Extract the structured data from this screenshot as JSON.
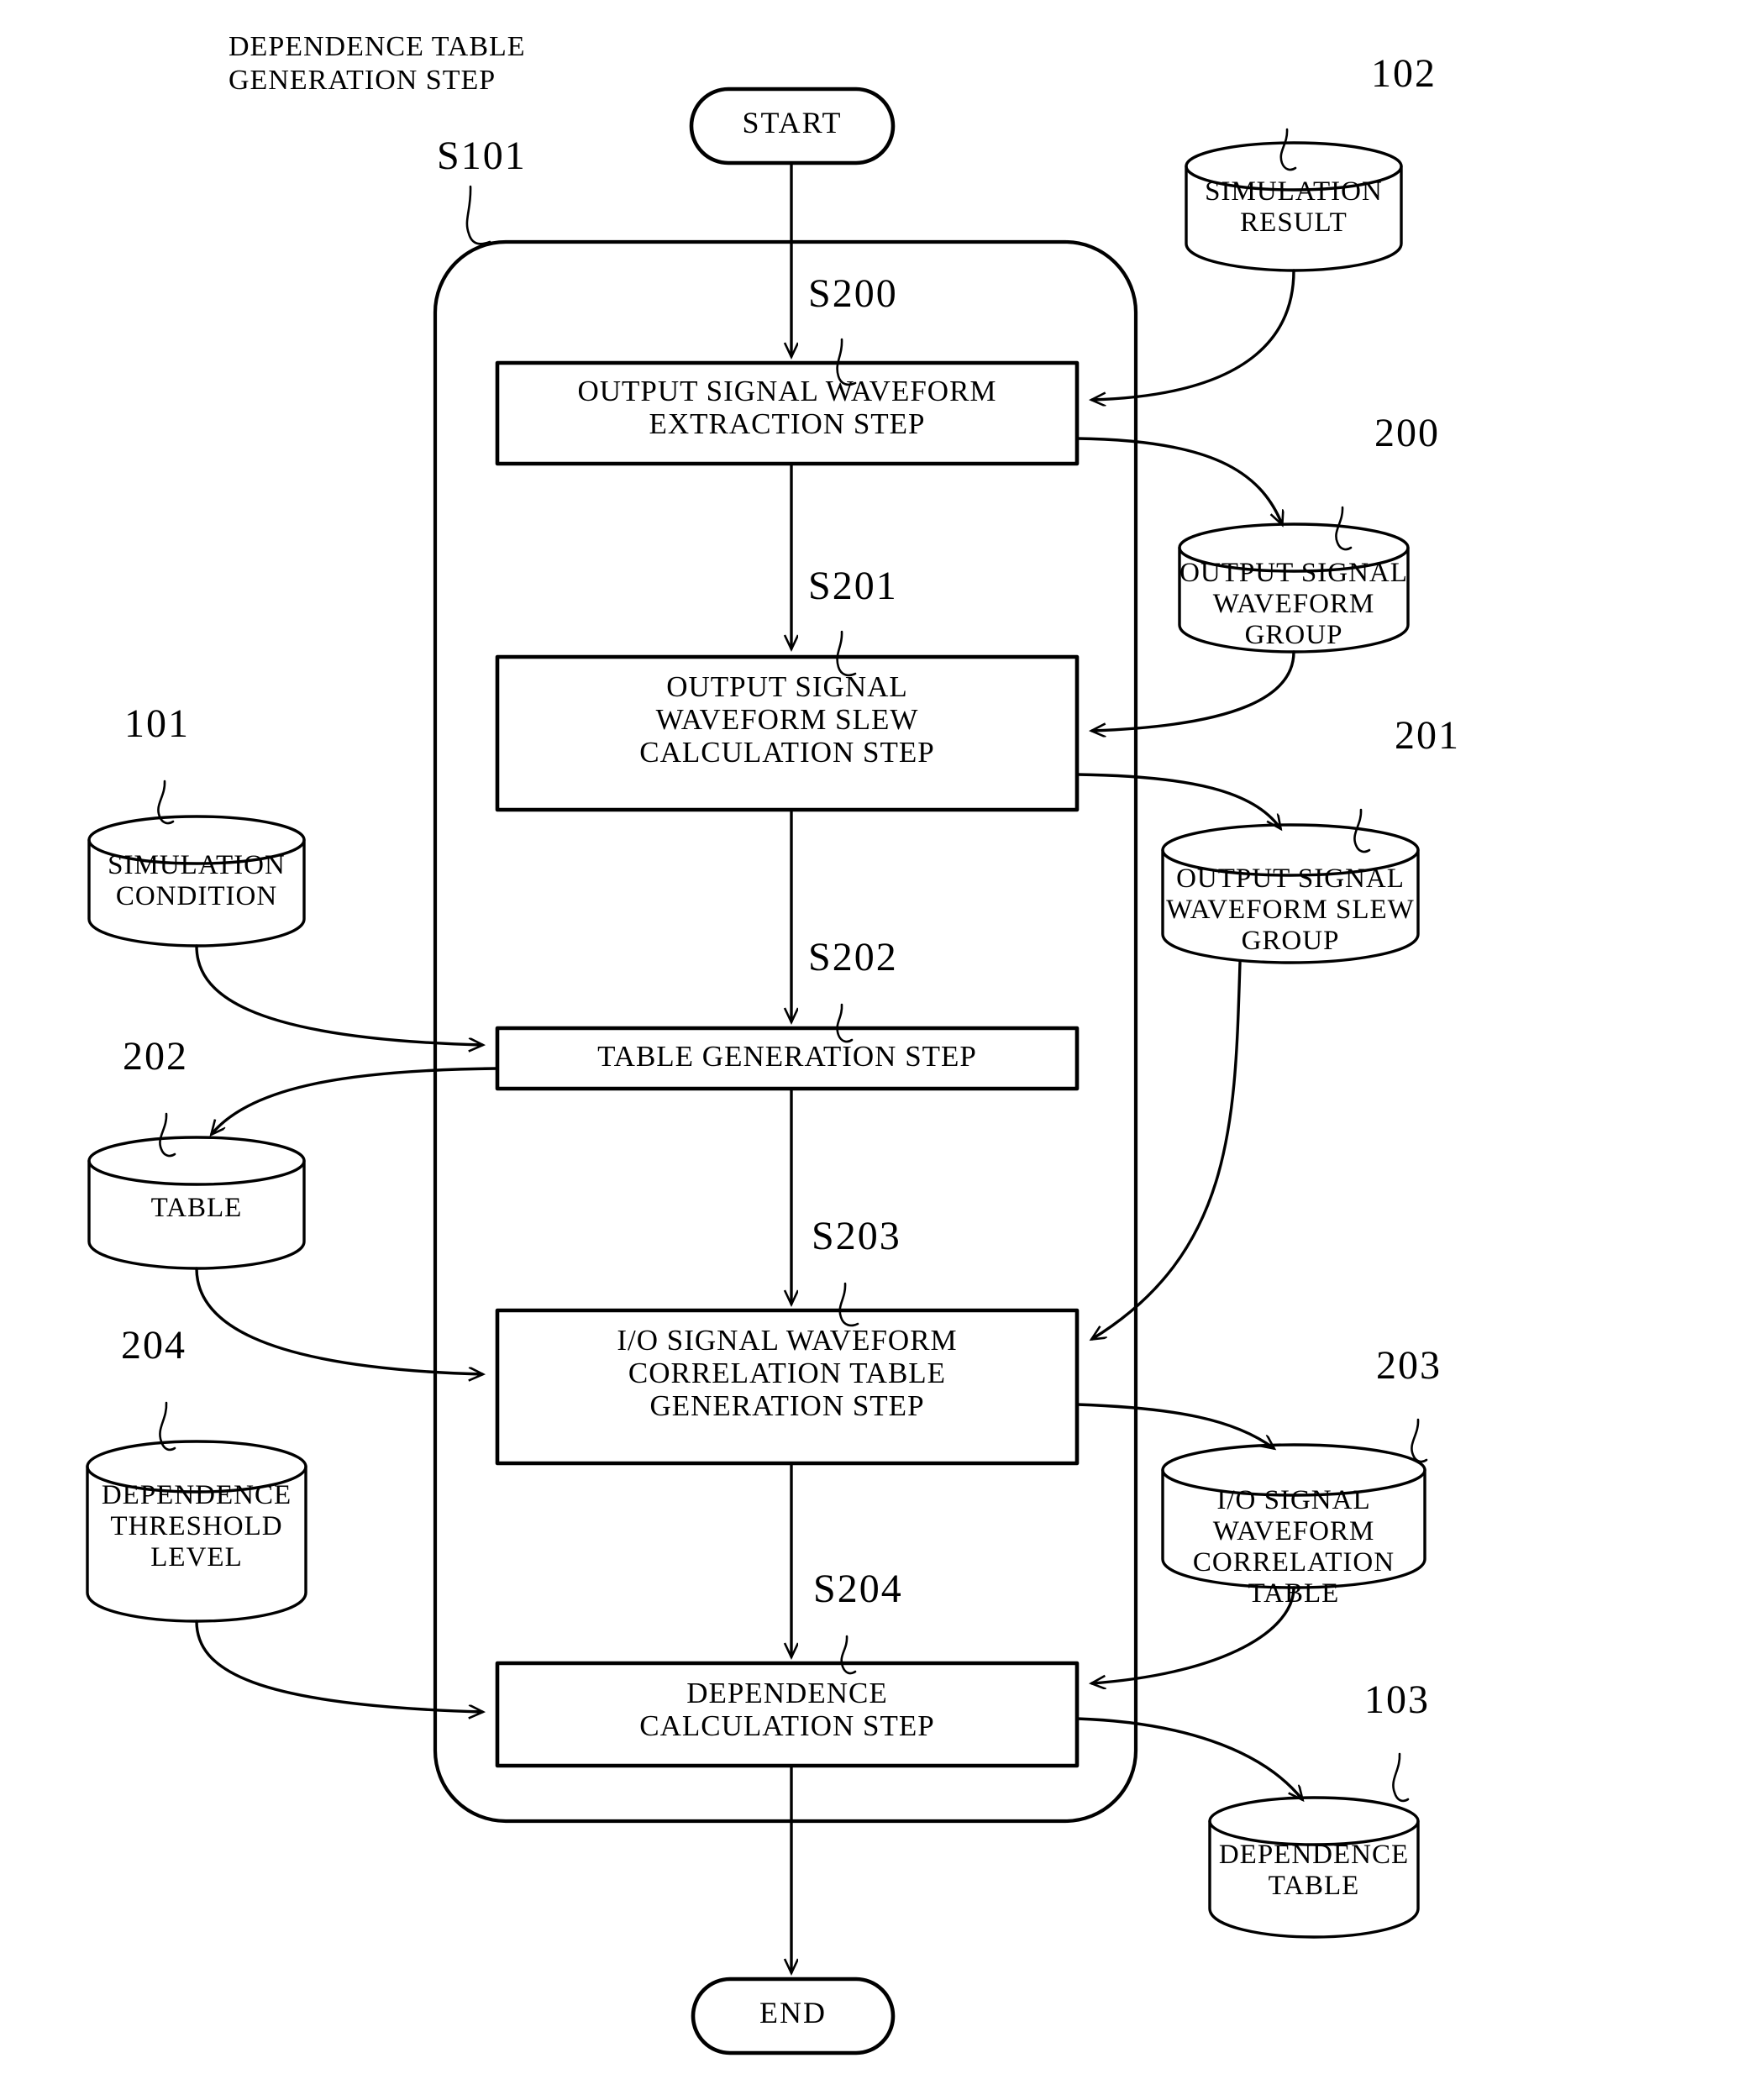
{
  "figure": {
    "title_lines": "DEPENDENCE TABLE\nGENERATION STEP",
    "container_ref": "S101"
  },
  "terminals": {
    "start": "START",
    "end": "END"
  },
  "steps": [
    {
      "ref": "S200",
      "label": "OUTPUT SIGNAL WAVEFORM\nEXTRACTION STEP"
    },
    {
      "ref": "S201",
      "label": "OUTPUT SIGNAL\nWAVEFORM SLEW\nCALCULATION STEP"
    },
    {
      "ref": "S202",
      "label": "TABLE GENERATION STEP"
    },
    {
      "ref": "S203",
      "label": "I/O SIGNAL WAVEFORM\nCORRELATION TABLE\nGENERATION STEP"
    },
    {
      "ref": "S204",
      "label": "DEPENDENCE\nCALCULATION STEP"
    }
  ],
  "stores": [
    {
      "ref": "102",
      "label": "SIMULATION\nRESULT"
    },
    {
      "ref": "200",
      "label": "OUTPUT SIGNAL\nWAVEFORM GROUP"
    },
    {
      "ref": "201",
      "label": "OUTPUT SIGNAL\nWAVEFORM SLEW GROUP"
    },
    {
      "ref": "101",
      "label": "SIMULATION\nCONDITION"
    },
    {
      "ref": "202",
      "label": "TABLE"
    },
    {
      "ref": "204",
      "label": "DEPENDENCE\nTHRESHOLD\nLEVEL"
    },
    {
      "ref": "203",
      "label": "I/O SIGNAL WAVEFORM\nCORRELATION TABLE"
    },
    {
      "ref": "103",
      "label": "DEPENDENCE\nTABLE"
    }
  ],
  "colors": {
    "ink": "#000000",
    "paper": "#ffffff"
  }
}
